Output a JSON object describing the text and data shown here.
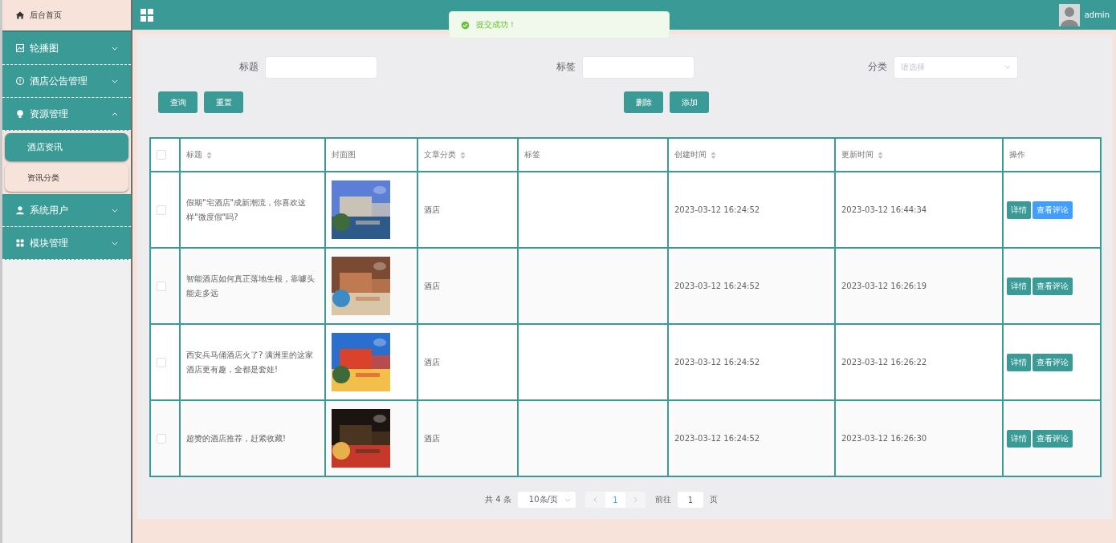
{
  "sidebar": {
    "items": [
      {
        "label": "后台首页",
        "kind": "link"
      },
      {
        "label": "轮播图",
        "kind": "menu",
        "expanded": false
      },
      {
        "label": "酒店公告管理",
        "kind": "menu",
        "expanded": false
      },
      {
        "label": "资源管理",
        "kind": "menu",
        "expanded": true,
        "children": [
          {
            "label": "酒店资讯",
            "selected": true
          },
          {
            "label": "资讯分类",
            "selected": false
          }
        ]
      },
      {
        "label": "系统用户",
        "kind": "menu",
        "expanded": false
      },
      {
        "label": "模块管理",
        "kind": "menu",
        "expanded": false
      }
    ]
  },
  "topbar": {
    "user": "admin"
  },
  "toast": {
    "message": "提交成功！"
  },
  "search": {
    "fields": [
      {
        "label": "标题",
        "kind": "input"
      },
      {
        "label": "标签",
        "kind": "input"
      },
      {
        "label": "分类",
        "kind": "select",
        "placeholder": "请选择"
      }
    ],
    "left_buttons": [
      "查询",
      "重置"
    ],
    "right_buttons": [
      "删除",
      "添加"
    ]
  },
  "table": {
    "all_checked": false,
    "columns": [
      {
        "label": "标题",
        "sortable": true
      },
      {
        "label": "封面图",
        "sortable": false
      },
      {
        "label": "文章分类",
        "sortable": true
      },
      {
        "label": "标签",
        "sortable": false
      },
      {
        "label": "创建时间",
        "sortable": true
      },
      {
        "label": "更新时间",
        "sortable": true
      },
      {
        "label": "操作",
        "sortable": false
      }
    ],
    "rows": [
      {
        "checked": false,
        "title": "假期\"宅酒店\"成新潮流，你喜欢这样\"微度假\"吗?",
        "category": "酒店",
        "created": "2023-03-12 16:24:52",
        "updated": "2023-03-12 16:44:34",
        "actions": [
          {
            "label": "详情",
            "highlighted": false
          },
          {
            "label": "查看评论",
            "highlighted": true
          }
        ]
      },
      {
        "checked": false,
        "title": "智能酒店如何真正落地生根，靠噱头能走多远",
        "category": "酒店",
        "created": "2023-03-12 16:24:52",
        "updated": "2023-03-12 16:26:19",
        "actions": [
          {
            "label": "详情",
            "highlighted": false
          },
          {
            "label": "查看评论",
            "highlighted": false
          }
        ]
      },
      {
        "checked": false,
        "title": "西安兵马俑酒店火了? 满洲里的这家酒店更有趣，全都是套娃!",
        "category": "酒店",
        "created": "2023-03-12 16:24:52",
        "updated": "2023-03-12 16:26:22",
        "actions": [
          {
            "label": "详情",
            "highlighted": false
          },
          {
            "label": "查看评论",
            "highlighted": false
          }
        ]
      },
      {
        "checked": false,
        "title": "超赞的酒店推荐，赶紧收藏!",
        "category": "酒店",
        "created": "2023-03-12 16:24:52",
        "updated": "2023-03-12 16:26:30",
        "actions": [
          {
            "label": "详情",
            "highlighted": false
          },
          {
            "label": "查看评论",
            "highlighted": false
          }
        ]
      }
    ]
  },
  "pagination": {
    "total": "共 4 条",
    "page_size": "10条/页",
    "pages": [
      {
        "label": "1",
        "selected": true
      }
    ],
    "goto_label": "前往",
    "goto_value": "1",
    "page_unit": "页"
  }
}
